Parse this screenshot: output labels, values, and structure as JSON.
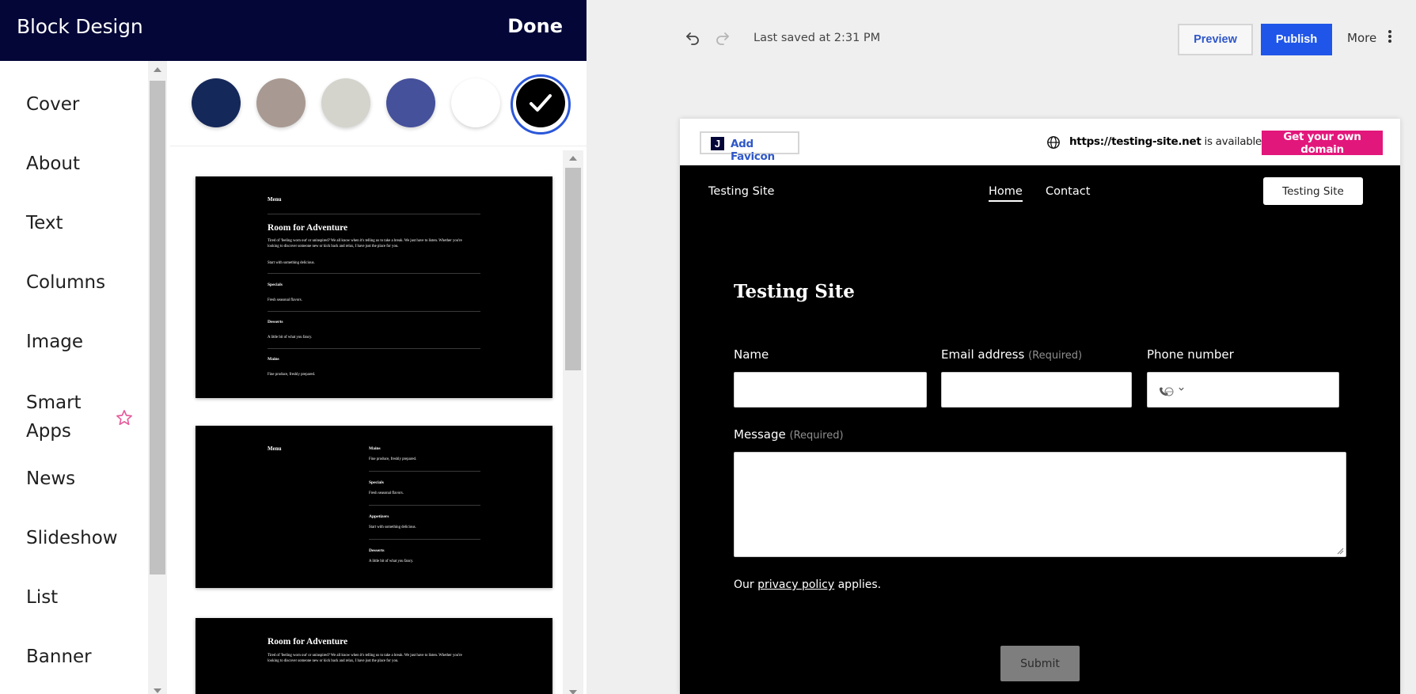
{
  "panel": {
    "title": "Block Design",
    "done_label": "Done",
    "nav_items": [
      {
        "label": "Cover"
      },
      {
        "label": "About"
      },
      {
        "label": "Text"
      },
      {
        "label": "Columns"
      },
      {
        "label": "Image"
      },
      {
        "label": "Smart\nApps",
        "icon": "star-icon"
      },
      {
        "label": "News"
      },
      {
        "label": "Slideshow"
      },
      {
        "label": "List"
      },
      {
        "label": "Banner"
      }
    ],
    "swatches": [
      {
        "color": "#15285a"
      },
      {
        "color": "#a89a92"
      },
      {
        "color": "#d4d4cd"
      },
      {
        "color": "#46519b"
      },
      {
        "color": "#ffffff"
      },
      {
        "color": "#000000",
        "selected": true
      }
    ],
    "accent_color": "#2b57d9",
    "layouts": [
      {
        "top_heading": "Menu",
        "title": "Room for Adventure",
        "body_line1": "Tired of 'feeling worn out' or uninspired? We all know when it's telling us to take a break. We just have to listen. Whether you're",
        "body_line2": "looking to discover someone new or kick back and relax, I have just the place for you.",
        "intro": "Start with something delicious.",
        "sections": [
          {
            "name": "Specials",
            "desc": "Fresh seasonal flavors."
          },
          {
            "name": "Desserts",
            "desc": "A little bit of what you fancy."
          },
          {
            "name": "Mains",
            "desc": "Fine produce, freshly prepared."
          }
        ]
      },
      {
        "left_heading": "Menu",
        "sections": [
          {
            "name": "Mains",
            "desc": "Fine produce, freshly prepared."
          },
          {
            "name": "Specials",
            "desc": "Fresh seasonal flavors."
          },
          {
            "name": "Appetizers",
            "desc": "Start with something delicious."
          },
          {
            "name": "Desserts",
            "desc": "A little bit of what you fancy."
          }
        ]
      },
      {
        "title": "Room for Adventure",
        "body_line1": "Tired of 'feeling worn out' or uninspired? We all know when it's telling us to take a break. We just have to listen. Whether you're",
        "body_line2": "looking to discover someone new or kick back and relax, I have just the place for you."
      }
    ]
  },
  "toolbar": {
    "last_saved": "Last saved at 2:31 PM",
    "preview_label": "Preview",
    "publish_label": "Publish",
    "more_label": "More"
  },
  "preview": {
    "add_favicon_label": "Add Favicon",
    "favicon_letter": "J",
    "domain": "https://testing-site.net",
    "domain_suffix": " is available!",
    "get_domain_label": "Get your own domain",
    "site_name": "Testing Site",
    "nav_home": "Home",
    "nav_contact": "Contact",
    "nav_cta": "Testing Site",
    "form_title": "Testing Site",
    "fields": {
      "name_label": "Name",
      "email_label": "Email address",
      "email_req": "(Required)",
      "phone_label": "Phone number",
      "message_label": "Message",
      "message_req": "(Required)"
    },
    "privacy_prefix": "Our ",
    "privacy_link": "privacy policy",
    "privacy_suffix": " applies.",
    "submit_label": "Submit",
    "brand_pink": "#e2177b",
    "brand_blue": "#1f55e8"
  }
}
